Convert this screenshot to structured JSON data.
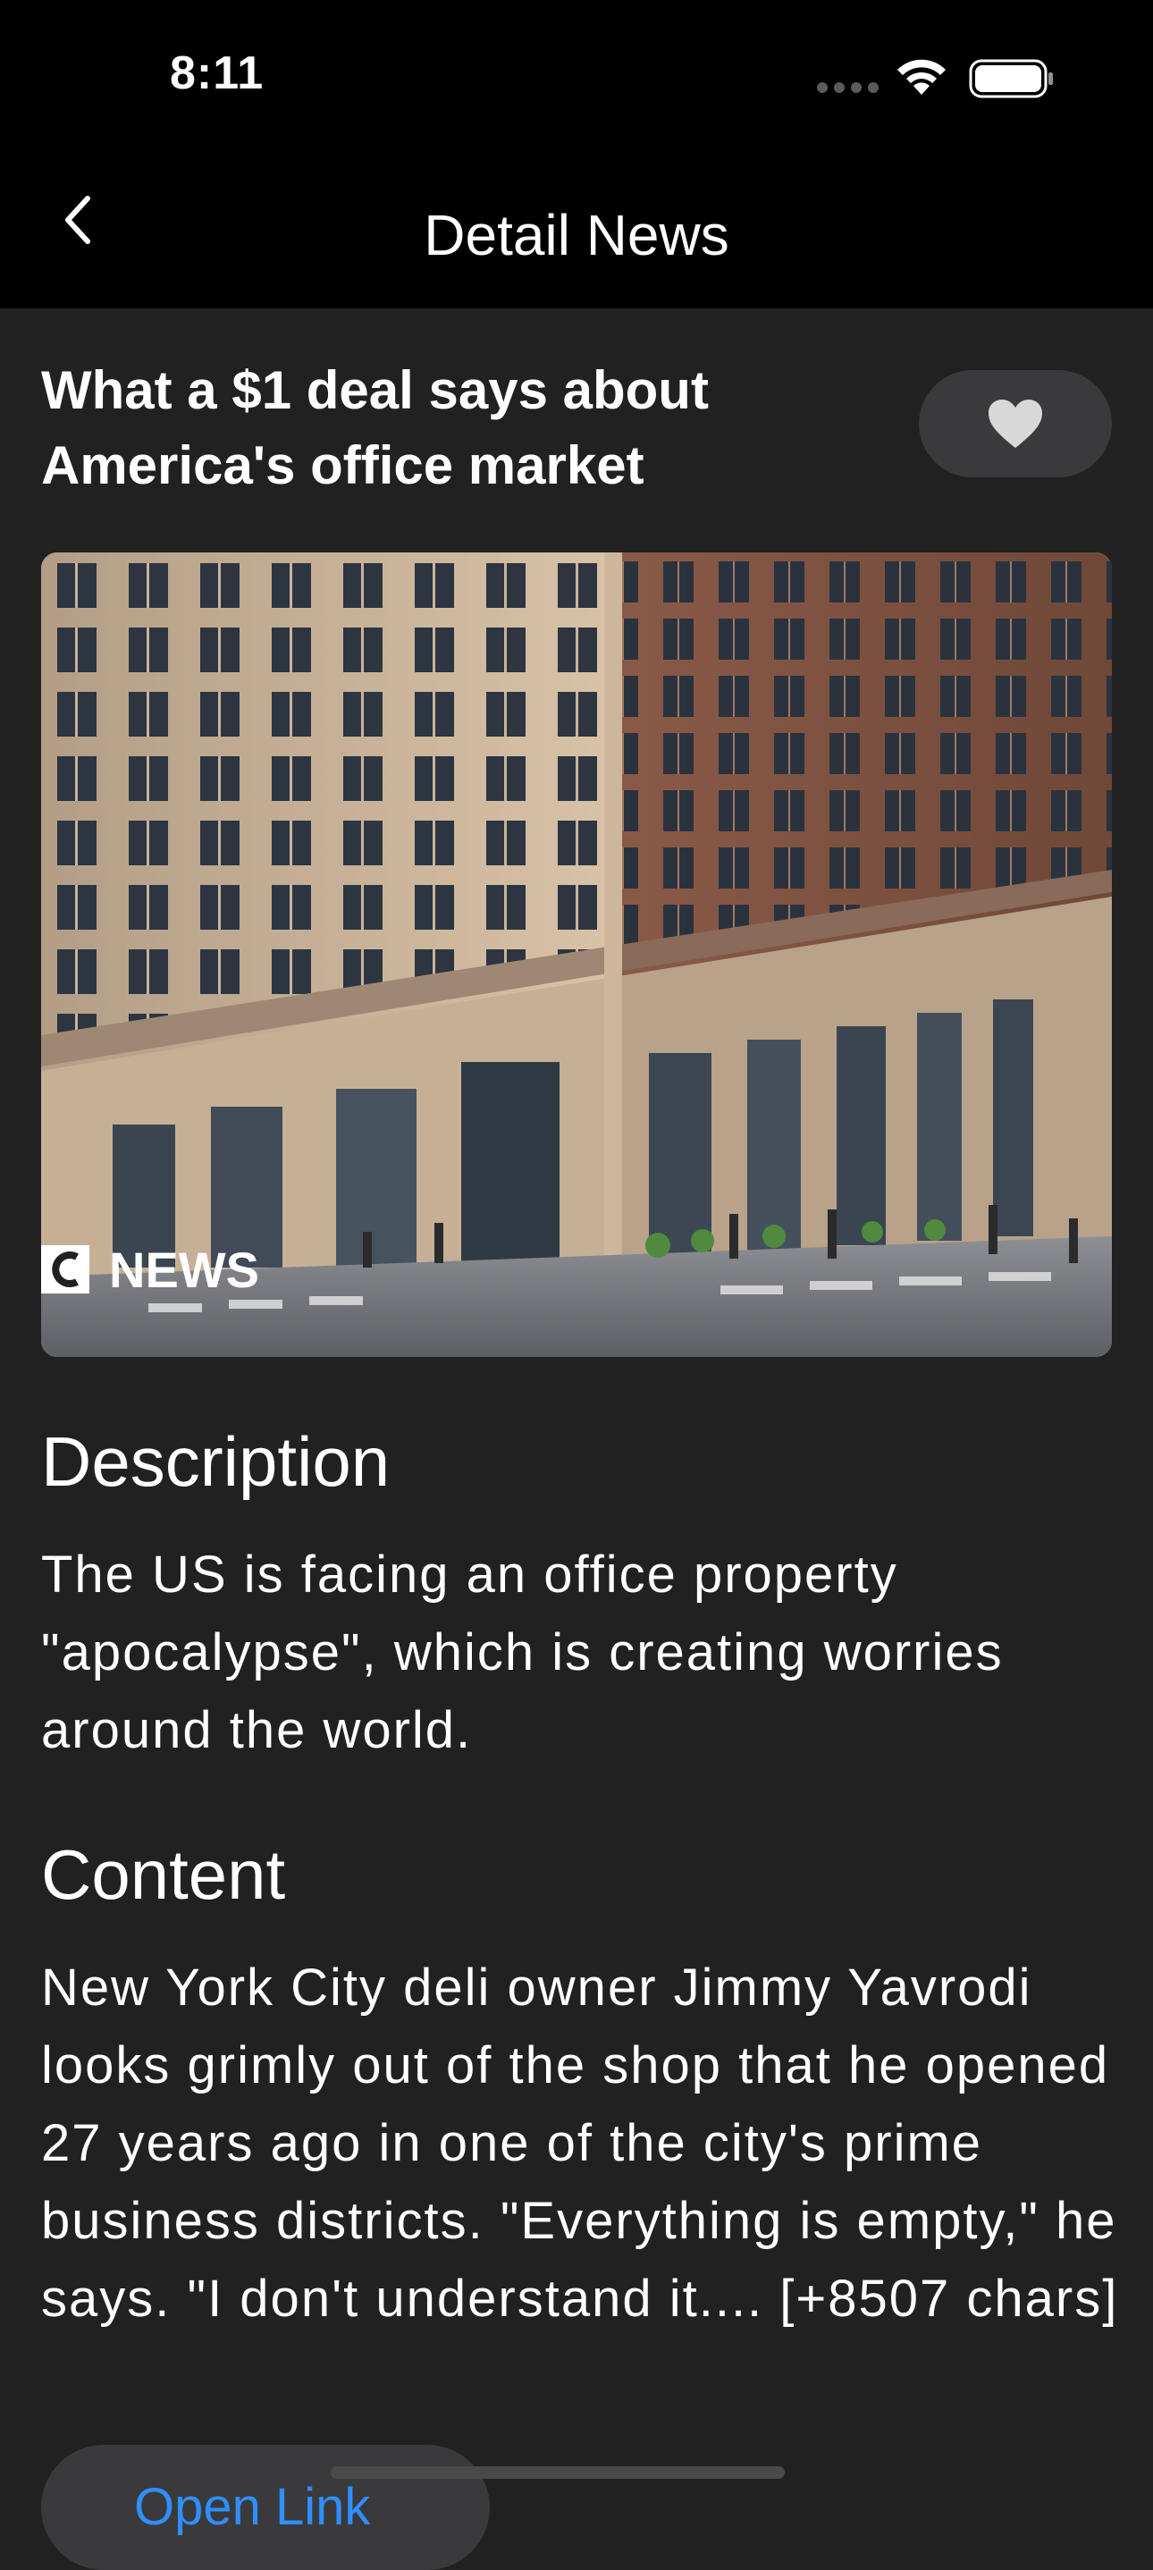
{
  "status_bar": {
    "time": "8:11"
  },
  "nav": {
    "title": "Detail News",
    "back_icon": "chevron-left-icon"
  },
  "article": {
    "headline": "What a $1 deal says about America's office market",
    "favorite_icon": "heart-icon",
    "image_watermark": "C NEWS",
    "description_heading": "Description",
    "description": "The US is facing an office property \"apocalypse\", which is creating worries around the world.",
    "content_heading": "Content",
    "content": "New York City deli owner Jimmy Yavrodi looks grimly out of the shop that he opened 27 years ago in one of the city's prime business districts. \"Everything is empty,\" he says. \"I don't understand it.... [+8507 chars]",
    "open_link_label": "Open Link"
  },
  "colors": {
    "background": "#212121",
    "bar_background": "#000000",
    "pill_background": "#3a3a3c",
    "link_blue": "#2f8fff"
  }
}
